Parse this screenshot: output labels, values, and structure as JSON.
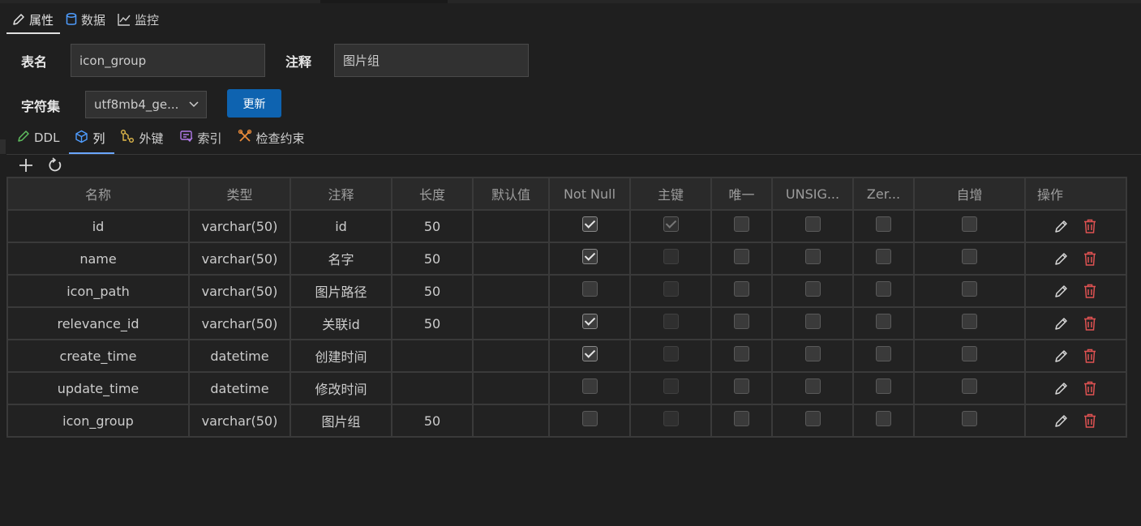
{
  "top_tabs": [
    {
      "label": "属性",
      "icon": "pencil-icon",
      "active": true
    },
    {
      "label": "数据",
      "icon": "database-icon",
      "active": false
    },
    {
      "label": "监控",
      "icon": "line-chart-icon",
      "active": false
    }
  ],
  "form": {
    "table_name_label": "表名",
    "table_name_value": "icon_group",
    "comment_label": "注释",
    "comment_value": "图片组",
    "charset_label": "字符集",
    "charset_value": "utf8mb4_ge...",
    "update_button": "更新"
  },
  "sub_tabs": [
    {
      "label": "DDL",
      "icon": "pencil-icon",
      "color": "#5fbf5f",
      "active": false
    },
    {
      "label": "列",
      "icon": "cube-icon",
      "color": "#4f9dff",
      "active": true
    },
    {
      "label": "外键",
      "icon": "foreign-key-icon",
      "color": "#e0b94a",
      "active": false
    },
    {
      "label": "索引",
      "icon": "index-icon",
      "color": "#b07ae8",
      "active": false
    },
    {
      "label": "检查约束",
      "icon": "tools-icon",
      "color": "#e88a3a",
      "active": false
    }
  ],
  "toolbar": {
    "add_icon": "plus-icon",
    "refresh_icon": "refresh-icon"
  },
  "table": {
    "headers": [
      "名称",
      "类型",
      "注释",
      "长度",
      "默认值",
      "Not Null",
      "主键",
      "唯一",
      "UNSIG...",
      "Zer...",
      "自增",
      "操作"
    ],
    "rows": [
      {
        "name": "id",
        "type": "varchar(50)",
        "comment": "id",
        "length": "50",
        "default": "",
        "not_null": true,
        "primary_key": true,
        "unique": false,
        "unsigned": false,
        "zerofill": false,
        "auto_increment": false
      },
      {
        "name": "name",
        "type": "varchar(50)",
        "comment": "名字",
        "length": "50",
        "default": "",
        "not_null": true,
        "primary_key": false,
        "unique": false,
        "unsigned": false,
        "zerofill": false,
        "auto_increment": false
      },
      {
        "name": "icon_path",
        "type": "varchar(50)",
        "comment": "图片路径",
        "length": "50",
        "default": "",
        "not_null": false,
        "primary_key": false,
        "unique": false,
        "unsigned": false,
        "zerofill": false,
        "auto_increment": false
      },
      {
        "name": "relevance_id",
        "type": "varchar(50)",
        "comment": "关联id",
        "length": "50",
        "default": "",
        "not_null": true,
        "primary_key": false,
        "unique": false,
        "unsigned": false,
        "zerofill": false,
        "auto_increment": false
      },
      {
        "name": "create_time",
        "type": "datetime",
        "comment": "创建时间",
        "length": "",
        "default": "",
        "not_null": true,
        "primary_key": false,
        "unique": false,
        "unsigned": false,
        "zerofill": false,
        "auto_increment": false
      },
      {
        "name": "update_time",
        "type": "datetime",
        "comment": "修改时间",
        "length": "",
        "default": "",
        "not_null": false,
        "primary_key": false,
        "unique": false,
        "unsigned": false,
        "zerofill": false,
        "auto_increment": false
      },
      {
        "name": "icon_group",
        "type": "varchar(50)",
        "comment": "图片组",
        "length": "50",
        "default": "",
        "not_null": false,
        "primary_key": false,
        "unique": false,
        "unsigned": false,
        "zerofill": false,
        "auto_increment": false
      }
    ],
    "row_actions": [
      "edit-icon",
      "delete-icon"
    ]
  },
  "colors": {
    "delete": "#e05252",
    "accent": "#0e63b0"
  }
}
